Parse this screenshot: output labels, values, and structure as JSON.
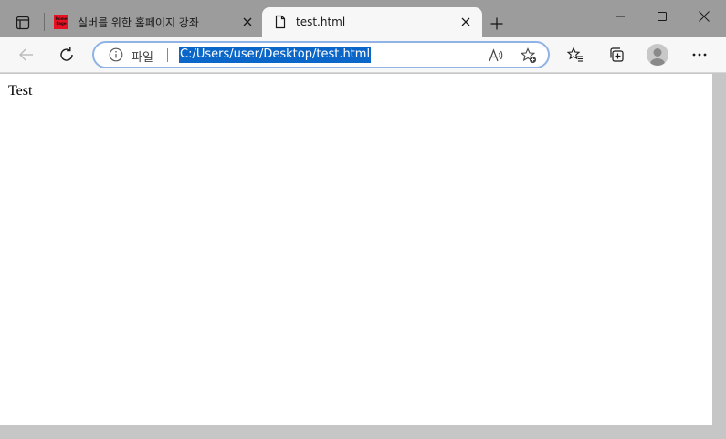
{
  "tabs": [
    {
      "title": "실버를 위한 홈페이지 강좌",
      "favicon_text": "Home Page",
      "active": false
    },
    {
      "title": "test.html",
      "active": true
    }
  ],
  "toolbar": {
    "site_label": "파일",
    "url": "C:/Users/user/Desktop/test.html"
  },
  "page": {
    "text": "Test"
  },
  "colors": {
    "tabbar_bg": "#9c9c9c",
    "toolbar_bg": "#f7f7f7",
    "url_highlight": "#0a66c8",
    "address_border": "#8fb3e6",
    "favicon_red": "#e81123"
  },
  "icons": [
    "tab-actions-icon",
    "close-icon",
    "plus-icon",
    "minimize-icon",
    "maximize-icon",
    "back-arrow-icon",
    "refresh-icon",
    "info-icon",
    "read-aloud-icon",
    "add-favorite-icon",
    "favorites-icon",
    "collections-icon",
    "avatar-icon",
    "more-icon"
  ]
}
